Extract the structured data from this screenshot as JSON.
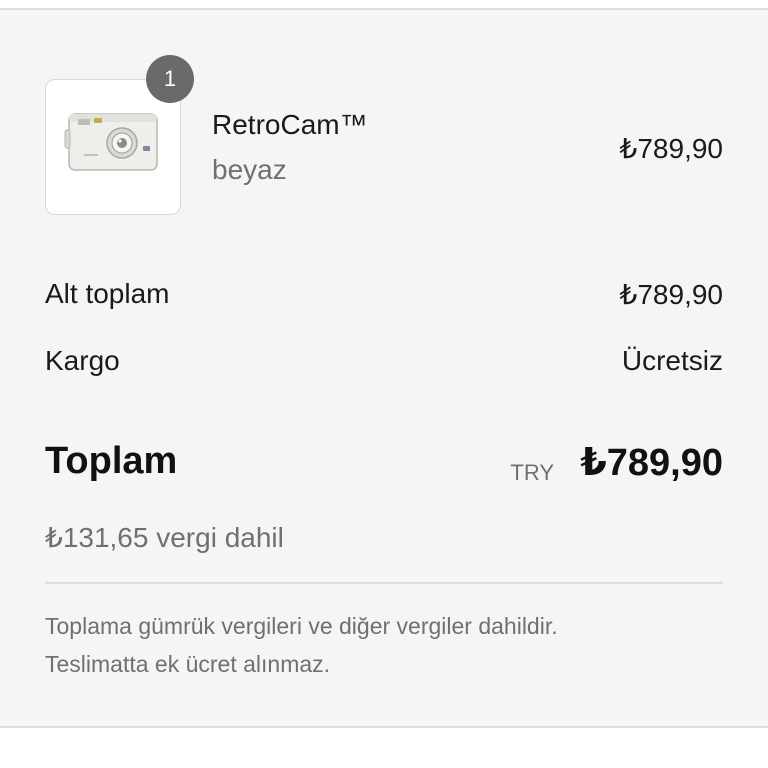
{
  "order_summary": {
    "item": {
      "quantity_badge": "1",
      "name": "RetroCam™",
      "variant": "beyaz",
      "price": "₺789,90",
      "image_icon": "camera-icon"
    },
    "subtotal": {
      "label": "Alt toplam",
      "value": "₺789,90"
    },
    "shipping": {
      "label": "Kargo",
      "value": "Ücretsiz"
    },
    "total": {
      "label": "Toplam",
      "currency": "TRY",
      "amount": "₺789,90"
    },
    "tax_note": "₺131,65 vergi dahil",
    "footnote": {
      "line1": "Toplama gümrük vergileri ve diğer vergiler dahildir.",
      "line2": "Teslimatta ek ücret alınmaz."
    }
  }
}
